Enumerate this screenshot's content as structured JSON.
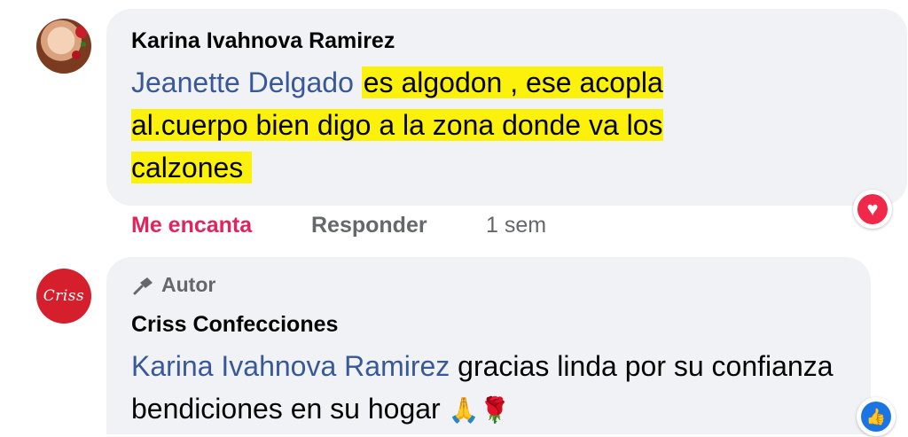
{
  "comments": [
    {
      "author": "Karina Ivahnova Ramirez",
      "mention": "Jeanette Delgado",
      "text": "es algodon , ese acopla al.cuerpo bien digo a la zona donde va los calzones",
      "highlight_color": "#fcf10a",
      "actions": {
        "reaction_label": "Me encanta",
        "reply_label": "Responder",
        "time": "1 sem"
      },
      "reaction_icon": "heart-icon"
    },
    {
      "badge": "Autor",
      "author": "Criss Confecciones",
      "mention": "Karina Ivahnova Ramirez",
      "text": "gracias linda por su confianza bendiciones en su hogar",
      "emojis": "🙏🌹",
      "avatar_text": "Criss",
      "reaction_icon": "like-icon"
    }
  ],
  "colors": {
    "mention": "#385898",
    "love": "#e0245e",
    "like": "#1b74e4",
    "bubble": "#f0f2f5"
  }
}
